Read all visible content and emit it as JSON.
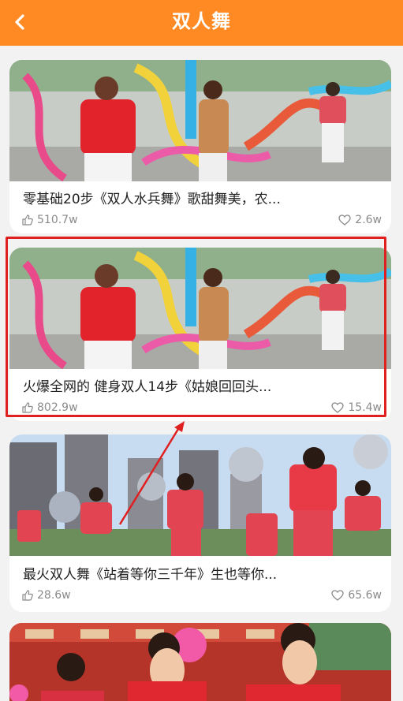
{
  "header": {
    "title": "双人舞"
  },
  "cards": [
    {
      "title": "零基础20步《双人水兵舞》歌甜舞美，农...",
      "views": "510.7w",
      "likes": "2.6w"
    },
    {
      "title": "火爆全网的 健身双人14步《姑娘回回头...",
      "views": "802.9w",
      "likes": "15.4w"
    },
    {
      "title": "最火双人舞《站着等你三千年》生也等你...",
      "views": "28.6w",
      "likes": "65.6w"
    },
    {
      "title": "",
      "views": "",
      "likes": ""
    }
  ],
  "colors": {
    "header": "#ff8a24",
    "highlight": "#e02020",
    "meta": "#8a8a8a"
  },
  "icons": {
    "back": "chevron-left-icon",
    "views": "thumb-up-icon",
    "likes": "heart-icon"
  }
}
